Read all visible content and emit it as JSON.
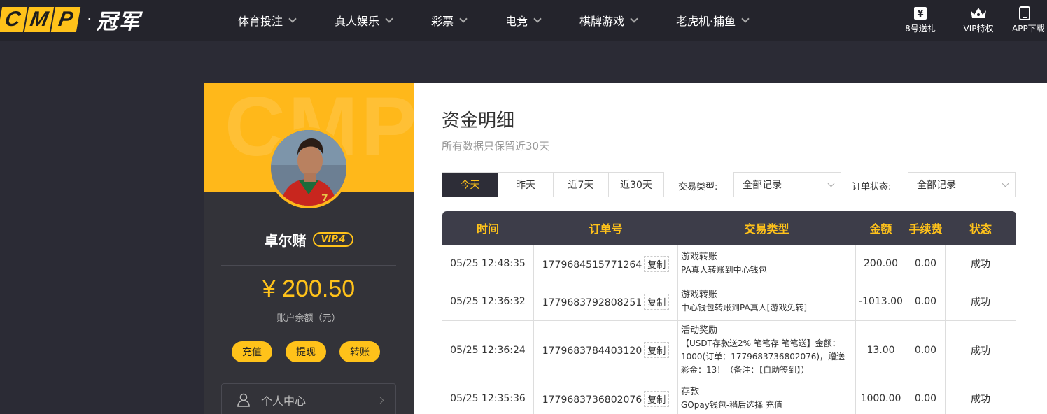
{
  "brand": {
    "letters": [
      "C",
      "M",
      "P"
    ],
    "dot": "·",
    "cn": "冠军"
  },
  "nav": [
    {
      "label": "体育投注"
    },
    {
      "label": "真人娱乐"
    },
    {
      "label": "彩票"
    },
    {
      "label": "电竞"
    },
    {
      "label": "棋牌游戏"
    },
    {
      "label": "老虎机·捕鱼"
    }
  ],
  "top_actions": [
    {
      "label": "8号送礼",
      "icon": "gift-yen-icon"
    },
    {
      "label": "VIP特权",
      "icon": "crown-icon"
    },
    {
      "label": "APP下载",
      "icon": "tablet-icon"
    }
  ],
  "profile": {
    "banner_watermark": "CMP",
    "username": "卓尔赌",
    "vip": "VIP.4",
    "balance": "¥ 200.50",
    "balance_label": "账户余额（元）",
    "buttons": [
      "充值",
      "提现",
      "转账"
    ],
    "menu_item": "个人中心"
  },
  "main": {
    "title": "资金明细",
    "subtitle": "所有数据只保留近30天",
    "tabs": [
      "今天",
      "昨天",
      "近7天",
      "近30天"
    ],
    "active_tab": 0,
    "filter_type_label": "交易类型:",
    "filter_type_value": "全部记录",
    "filter_status_label": "订单状态:",
    "filter_status_value": "全部记录"
  },
  "table": {
    "headers": [
      "时间",
      "订单号",
      "交易类型",
      "金额",
      "手续费",
      "状态"
    ],
    "copy_label": "复制",
    "rows": [
      {
        "time": "05/25 12:48:35",
        "order": "1779684515771264",
        "type": "游戏转账",
        "desc": "PA真人转账到中心钱包",
        "amount": "200.00",
        "fee": "0.00",
        "status": "成功"
      },
      {
        "time": "05/25 12:36:32",
        "order": "1779683792808251",
        "type": "游戏转账",
        "desc": "中心钱包转账到PA真人[游戏免转]",
        "amount": "-1013.00",
        "fee": "0.00",
        "status": "成功"
      },
      {
        "time": "05/25 12:36:24",
        "order": "1779683784403120",
        "type": "活动奖励",
        "desc": "【USDT存款送2% 笔笔存 笔笔送】金额：1000(订单：1779683736802076)，赠送彩金：13！（备注：【自助签到】）",
        "amount": "13.00",
        "fee": "0.00",
        "status": "成功"
      },
      {
        "time": "05/25 12:35:36",
        "order": "1779683736802076",
        "type": "存款",
        "desc": "GOpay钱包-稍后选择 充值",
        "amount": "1000.00",
        "fee": "0.00",
        "status": "成功"
      }
    ]
  },
  "colors": {
    "accent": "#ffc21a",
    "dark_bg": "#2b2b35",
    "header_bg": "#24242c",
    "table_head": "#3d3d49",
    "success": "#3a9a3a"
  }
}
